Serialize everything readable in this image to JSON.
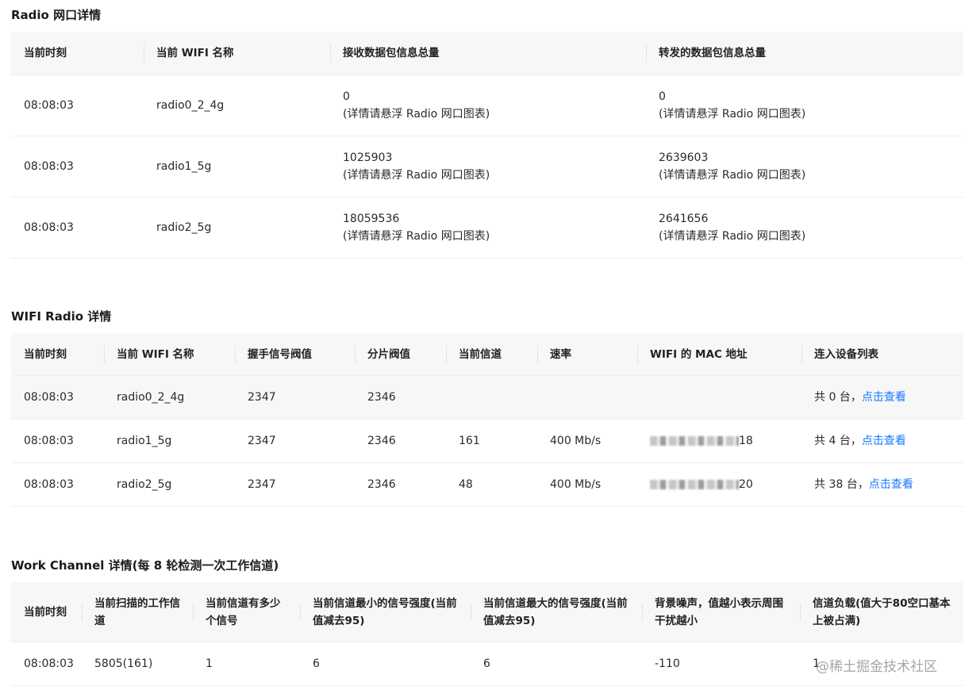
{
  "radio_port": {
    "title": "Radio 网口详情",
    "headers": [
      "当前时刻",
      "当前 WIFI 名称",
      "接收数据包信息总量",
      "转发的数据包信息总量"
    ],
    "rows": [
      {
        "time": "08:08:03",
        "name": "radio0_2_4g",
        "rx": "0",
        "tx": "0"
      },
      {
        "time": "08:08:03",
        "name": "radio1_5g",
        "rx": "1025903",
        "tx": "2639603"
      },
      {
        "time": "08:08:03",
        "name": "radio2_5g",
        "rx": "18059536",
        "tx": "2641656"
      }
    ],
    "hint": "(详情请悬浮 Radio 网口图表)"
  },
  "wifi_radio": {
    "title": "WIFI Radio 详情",
    "headers": [
      "当前时刻",
      "当前 WIFI 名称",
      "握手信号阀值",
      "分片阀值",
      "当前信道",
      "速率",
      "WIFI 的 MAC 地址",
      "连入设备列表"
    ],
    "rows": [
      {
        "time": "08:08:03",
        "name": "radio0_2_4g",
        "handshake": "2347",
        "frag": "2346",
        "channel": "",
        "rate": "",
        "mac_suffix": "",
        "devices": "共 0 台，",
        "link": "点击查看"
      },
      {
        "time": "08:08:03",
        "name": "radio1_5g",
        "handshake": "2347",
        "frag": "2346",
        "channel": "161",
        "rate": "400 Mb/s",
        "mac_suffix": "18",
        "devices": "共 4 台，",
        "link": "点击查看"
      },
      {
        "time": "08:08:03",
        "name": "radio2_5g",
        "handshake": "2347",
        "frag": "2346",
        "channel": "48",
        "rate": "400 Mb/s",
        "mac_suffix": "20",
        "devices": "共 38 台，",
        "link": "点击查看"
      }
    ]
  },
  "work_channel": {
    "title": "Work Channel 详情(每 8 轮检测一次工作信道)",
    "headers": [
      "当前时刻",
      "当前扫描的工作信道",
      "当前信道有多少个信号",
      "当前信道最小的信号强度(当前值减去95)",
      "当前信道最大的信号强度(当前值减去95)",
      "背景噪声，值越小表示周围干扰越小",
      "信道负载(值大于80空口基本上被占满)"
    ],
    "rows": [
      {
        "time": "08:08:03",
        "channel": "5805(161)",
        "signals": "1",
        "min": "6",
        "max": "6",
        "noise": "-110",
        "load": "1"
      }
    ]
  },
  "watermark": "@稀土掘金技术社区",
  "colors": {
    "link": "#1677ff",
    "header_bg": "#f7f7f7",
    "border": "#eeeeee"
  }
}
